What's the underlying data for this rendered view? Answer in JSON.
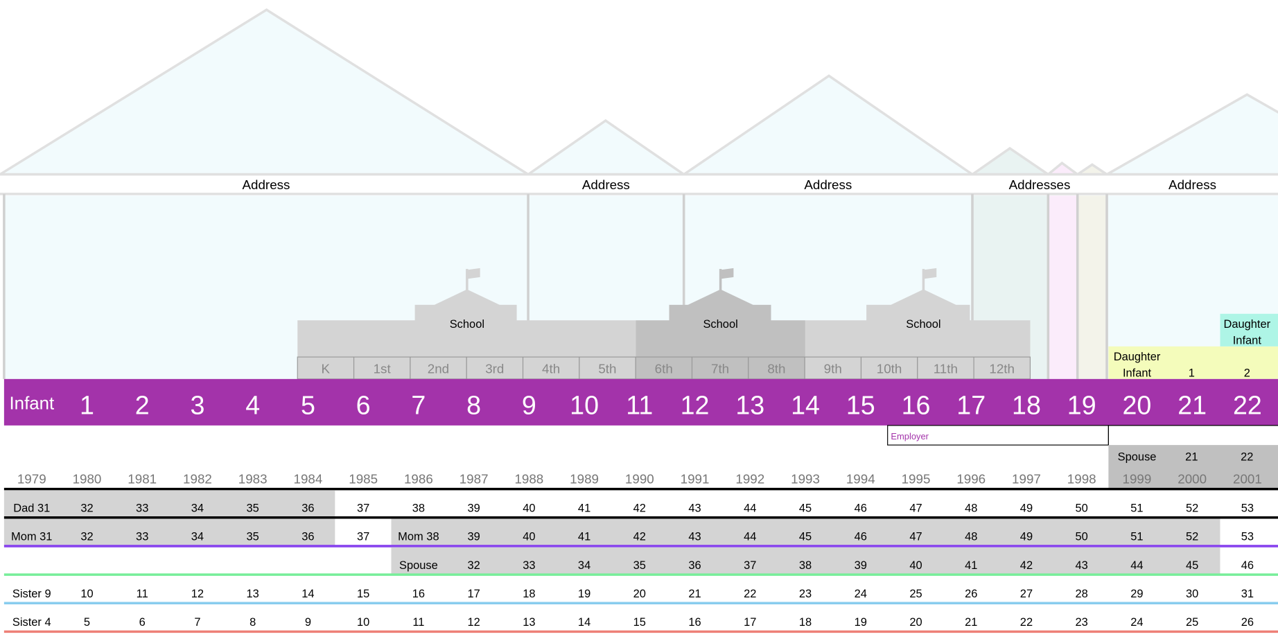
{
  "colors": {
    "band": "#a333aa",
    "panel": "#f2fbfd",
    "mountain_stroke": "#e0e0e0",
    "gray": "#d4d4d4",
    "dark_gray": "#c0c0c0",
    "daughter1": "#f4fcbb",
    "daughter2": "#aef5e6",
    "employer_text": "#a333aa",
    "dad_line": "#000000",
    "mom_line": "#8844ee",
    "spouse_line": "#77ee99",
    "sister9_line": "#88ccee",
    "sister4_line": "#ee8077",
    "addr_sub": [
      "#e9f3f2",
      "#fbecfb",
      "#f3f3ea"
    ]
  },
  "addresses": [
    "Address",
    "Address",
    "Address",
    "Addresses",
    "Address"
  ],
  "schools": [
    "School",
    "School",
    "School"
  ],
  "grades": [
    "K",
    "1st",
    "2nd",
    "3rd",
    "4th",
    "5th",
    "6th",
    "7th",
    "8th",
    "9th",
    "10th",
    "11th",
    "12th"
  ],
  "ages": [
    "Infant",
    "1",
    "2",
    "3",
    "4",
    "5",
    "6",
    "7",
    "8",
    "9",
    "10",
    "11",
    "12",
    "13",
    "14",
    "15",
    "16",
    "17",
    "18",
    "19",
    "20",
    "21",
    "22"
  ],
  "employer": "Employer",
  "daughter1": {
    "line1": "Daughter",
    "line2": "Infant",
    "ages": [
      "1",
      "2"
    ]
  },
  "daughter2": {
    "line1": "Daughter",
    "line2": "Infant"
  },
  "spouse_top": {
    "label": "Spouse",
    "ages": [
      "21",
      "22"
    ]
  },
  "years": [
    "1979",
    "1980",
    "1981",
    "1982",
    "1983",
    "1984",
    "1985",
    "1986",
    "1987",
    "1988",
    "1989",
    "1990",
    "1991",
    "1992",
    "1993",
    "1994",
    "1995",
    "1996",
    "1997",
    "1998",
    "1999",
    "2000",
    "2001"
  ],
  "rows": [
    {
      "name": "dad",
      "cells": [
        "Dad 31",
        "32",
        "33",
        "34",
        "35",
        "36",
        "37",
        "38",
        "39",
        "40",
        "41",
        "42",
        "43",
        "44",
        "45",
        "46",
        "47",
        "48",
        "49",
        "50",
        "51",
        "52",
        "53"
      ]
    },
    {
      "name": "mom",
      "cells": [
        "Mom 31",
        "32",
        "33",
        "34",
        "35",
        "36",
        "37",
        "Mom 38",
        "39",
        "40",
        "41",
        "42",
        "43",
        "44",
        "45",
        "46",
        "47",
        "48",
        "49",
        "50",
        "51",
        "52",
        "53"
      ]
    },
    {
      "name": "spouse",
      "cells": [
        "",
        "",
        "",
        "",
        "",
        "",
        "",
        "Spouse",
        "32",
        "33",
        "34",
        "35",
        "36",
        "37",
        "38",
        "39",
        "40",
        "41",
        "42",
        "43",
        "44",
        "45",
        "46"
      ]
    },
    {
      "name": "sister-9",
      "cells": [
        "Sister 9",
        "10",
        "11",
        "12",
        "13",
        "14",
        "15",
        "16",
        "17",
        "18",
        "19",
        "20",
        "21",
        "22",
        "23",
        "24",
        "25",
        "26",
        "27",
        "28",
        "29",
        "30",
        "31"
      ]
    },
    {
      "name": "sister-4",
      "cells": [
        "Sister 4",
        "5",
        "6",
        "7",
        "8",
        "9",
        "10",
        "11",
        "12",
        "13",
        "14",
        "15",
        "16",
        "17",
        "18",
        "19",
        "20",
        "21",
        "22",
        "23",
        "24",
        "25",
        "26"
      ]
    }
  ]
}
